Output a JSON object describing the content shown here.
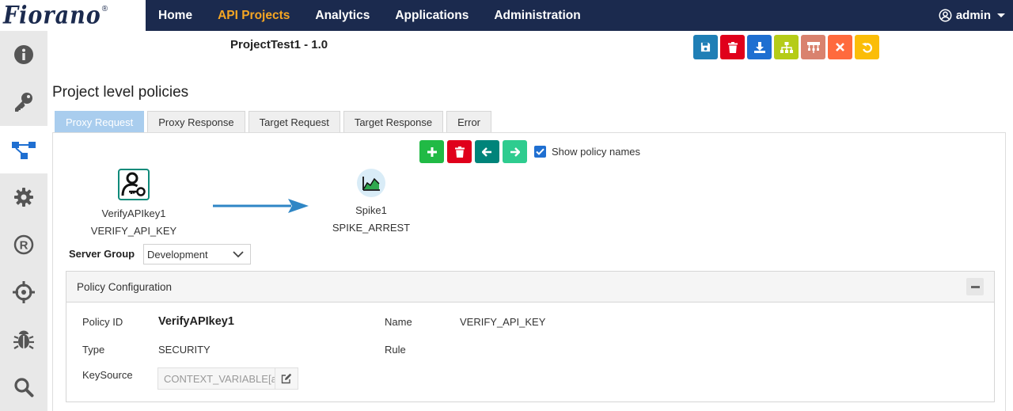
{
  "brand": {
    "name": "Fiorano",
    "mark": "®"
  },
  "nav": {
    "items": [
      {
        "label": "Home",
        "active": false
      },
      {
        "label": "API Projects",
        "active": true
      },
      {
        "label": "Analytics",
        "active": false
      },
      {
        "label": "Applications",
        "active": false
      },
      {
        "label": "Administration",
        "active": false
      }
    ],
    "user": "admin"
  },
  "sidebar": {
    "items": [
      {
        "icon": "info-icon",
        "active": false
      },
      {
        "icon": "key-icon",
        "active": false
      },
      {
        "icon": "flow-icon",
        "active": true
      },
      {
        "icon": "gear-icon",
        "active": false
      },
      {
        "icon": "registered-icon",
        "active": false
      },
      {
        "icon": "crosshair-icon",
        "active": false
      },
      {
        "icon": "bug-icon",
        "active": false
      },
      {
        "icon": "search-icon",
        "active": false
      }
    ]
  },
  "project": {
    "title": "ProjectTest1 - 1.0"
  },
  "toolbar": {
    "buttons": [
      {
        "icon": "save-icon",
        "color": "#1f7fb6"
      },
      {
        "icon": "trash-icon",
        "color": "#e0001b"
      },
      {
        "icon": "download-icon",
        "color": "#1f6fd1"
      },
      {
        "icon": "hierarchy-icon",
        "color": "#b5cc18"
      },
      {
        "icon": "branch-icon",
        "color": "#d9826e"
      },
      {
        "icon": "close-icon",
        "color": "#ff6a3d"
      },
      {
        "icon": "undo-icon",
        "color": "#fbbd08"
      }
    ]
  },
  "policies": {
    "section_title": "Project level policies",
    "tabs": [
      {
        "label": "Proxy Request",
        "active": true
      },
      {
        "label": "Proxy Response",
        "active": false
      },
      {
        "label": "Target Request",
        "active": false
      },
      {
        "label": "Target Response",
        "active": false
      },
      {
        "label": "Error",
        "active": false
      }
    ],
    "show_policy_names_label": "Show policy names",
    "show_policy_names": true,
    "flow_buttons": [
      {
        "icon": "plus-icon",
        "color": "#21ba45"
      },
      {
        "icon": "trash-icon",
        "color": "#e0001b"
      },
      {
        "icon": "arrow-left-icon",
        "color": "#00847a"
      },
      {
        "icon": "arrow-right-icon",
        "color": "#2ecc8f"
      }
    ],
    "nodes": [
      {
        "name": "VerifyAPIkey1",
        "type": "VERIFY_API_KEY"
      },
      {
        "name": "Spike1",
        "type": "SPIKE_ARREST"
      }
    ]
  },
  "server_group": {
    "label": "Server Group",
    "value": "Development"
  },
  "config": {
    "title": "Policy Configuration",
    "policy_id_label": "Policy ID",
    "policy_id": "VerifyAPIkey1",
    "name_label": "Name",
    "name": "VERIFY_API_KEY",
    "type_label": "Type",
    "type": "SECURITY",
    "rule_label": "Rule",
    "keysource_label": "KeySource",
    "keysource_value": "CONTEXT_VARIABLE[apikey]"
  }
}
